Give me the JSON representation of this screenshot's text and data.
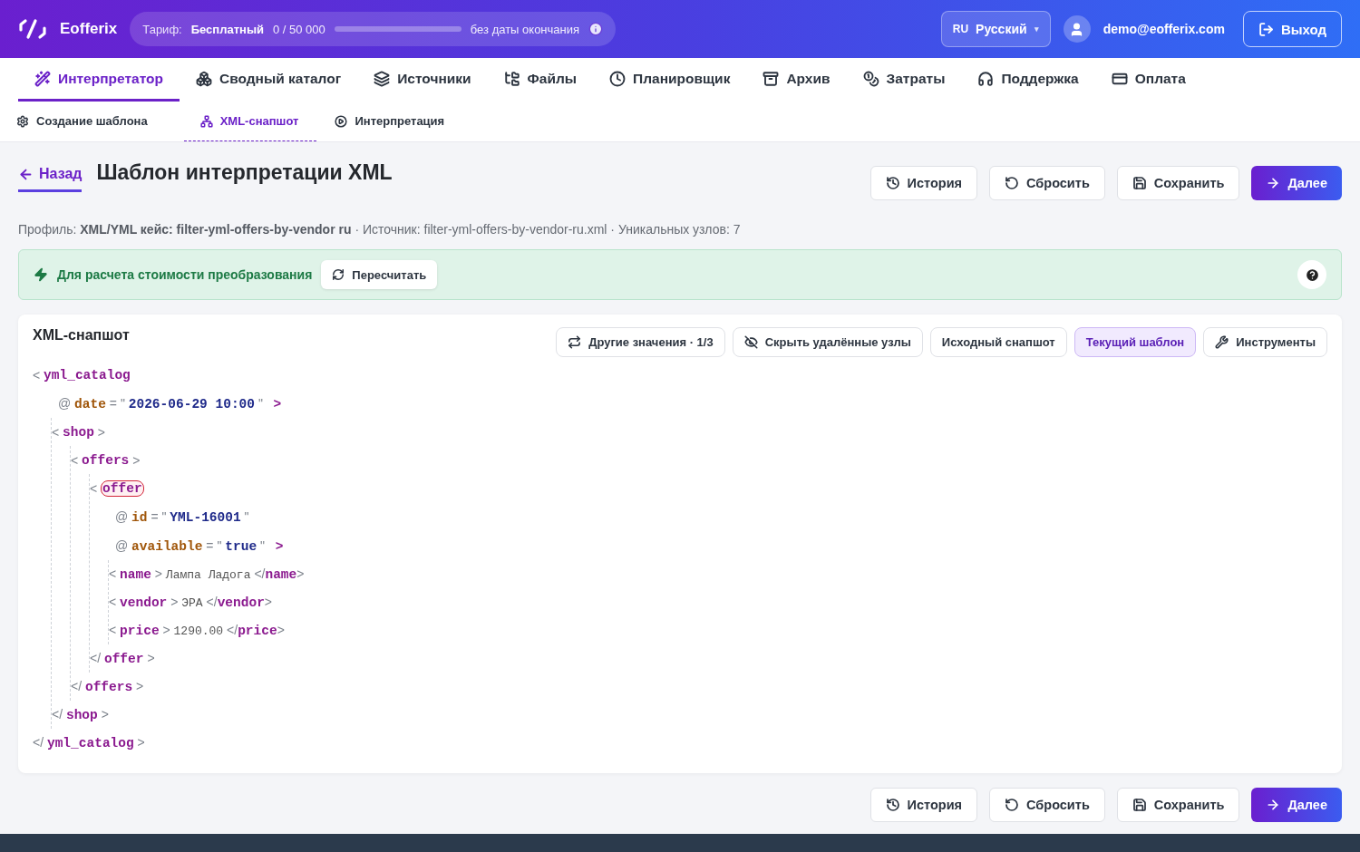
{
  "header": {
    "brand": "Eofferix",
    "tariff": {
      "label": "Тариф:",
      "plan": "Бесплатный",
      "usage": "0 / 50 000",
      "level": 0,
      "expiry": "без даты окончания"
    },
    "language": {
      "code": "RU",
      "name": "Русский",
      "caret": "▾"
    },
    "user": "demo@eofferix.com",
    "logout": "Выход"
  },
  "nav": [
    {
      "label": "Интерпретатор",
      "selected": true
    },
    {
      "label": "Сводный каталог",
      "selected": false
    },
    {
      "label": "Источники",
      "selected": false
    },
    {
      "label": "Файлы",
      "selected": false
    },
    {
      "label": "Планировщик",
      "selected": false
    },
    {
      "label": "Архив",
      "selected": false
    },
    {
      "label": "Затраты",
      "selected": false
    },
    {
      "label": "Поддержка",
      "selected": false
    },
    {
      "label": "Оплата",
      "selected": false
    }
  ],
  "subnav": [
    {
      "label": "Создание шаблона",
      "selected": false
    },
    {
      "label": "XML-снапшот",
      "selected": true
    },
    {
      "label": "Интерпретация",
      "selected": false
    }
  ],
  "page": {
    "back": "Назад",
    "title": "Шаблон интерпретации XML",
    "actions": [
      {
        "label": "История",
        "kind": "plain"
      },
      {
        "label": "Сбросить",
        "kind": "plain"
      },
      {
        "label": "Сохранить",
        "kind": "plain"
      },
      {
        "label": "Далее",
        "kind": "primary"
      }
    ],
    "meta": "Профиль: **XML/YML кейс: filter-yml-offers-by-vendor ru** · Источник: filter-yml-offers-by-vendor-ru.xml · Уникальных узлов: 7"
  },
  "notice": {
    "text": "Для расчета стоимости преобразования",
    "button": "Пересчитать"
  },
  "snapshot": {
    "title": "XML-снапшот",
    "tools": [
      {
        "label": "Другие значения · 1/3",
        "selected": false
      },
      {
        "label": "Скрыть удалённые узлы",
        "selected": false
      },
      {
        "label": "Исходный снапшот",
        "selected": false
      },
      {
        "label": "Текущий шаблон",
        "selected": true
      },
      {
        "label": "Инструменты",
        "selected": false
      }
    ],
    "syntax": {
      "open": "<",
      "close": ">",
      "end_open": "</",
      "attr": "@",
      "equals": "=",
      "quote": "\""
    },
    "xml_tree": {
      "name": "yml_catalog",
      "close_name": "yml_catalog",
      "highlighted": false,
      "attributes": [
        {
          "name": "date",
          "value": "2026-06-29 10:00"
        }
      ],
      "children": [
        {
          "name": "shop",
          "close_name": "shop",
          "highlighted": false,
          "children": [
            {
              "name": "offers",
              "close_name": "offers",
              "highlighted": false,
              "children": [
                {
                  "name": "offer",
                  "close_name": "offer",
                  "highlighted": true,
                  "attributes": [
                    {
                      "name": "id",
                      "value": "YML-16001"
                    },
                    {
                      "name": "available",
                      "value": "true"
                    }
                  ],
                  "children": [
                    {
                      "name": "name",
                      "close_name": "name",
                      "text": "Лампа Ладога",
                      "highlighted": false
                    },
                    {
                      "name": "vendor",
                      "close_name": "vendor",
                      "text": "ЭРА",
                      "highlighted": false
                    },
                    {
                      "name": "price",
                      "close_name": "price",
                      "text": "1290.00",
                      "highlighted": false
                    }
                  ]
                }
              ]
            }
          ]
        }
      ]
    }
  },
  "footer_actions": [
    {
      "label": "История",
      "kind": "plain"
    },
    {
      "label": "Сбросить",
      "kind": "plain"
    },
    {
      "label": "Сохранить",
      "kind": "plain"
    },
    {
      "label": "Далее",
      "kind": "primary"
    }
  ]
}
